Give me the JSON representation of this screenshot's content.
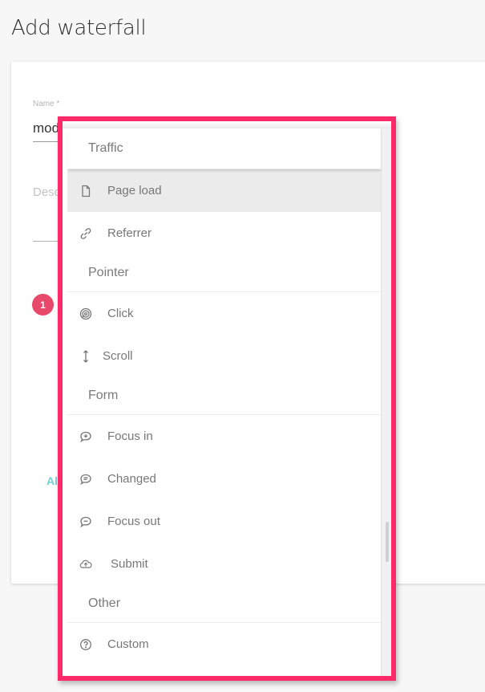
{
  "page": {
    "title": "Add waterfall"
  },
  "form": {
    "name_label": "Name *",
    "name_value": "mod",
    "description_placeholder": "Desc",
    "step_badge": "1",
    "add_link": "Al"
  },
  "dropdown": {
    "groups": [
      {
        "header": "Traffic",
        "items": [
          {
            "label": "Page load",
            "icon": "file-icon",
            "active": true
          },
          {
            "label": "Referrer",
            "icon": "link-icon",
            "active": false
          }
        ]
      },
      {
        "header": "Pointer",
        "items": [
          {
            "label": "Click",
            "icon": "fingerprint-icon",
            "active": false
          },
          {
            "label": "Scroll",
            "icon": "vertical-arrows-icon",
            "active": false
          }
        ]
      },
      {
        "header": "Form",
        "items": [
          {
            "label": "Focus in",
            "icon": "comment-plus-icon",
            "active": false
          },
          {
            "label": "Changed",
            "icon": "comment-lines-icon",
            "active": false
          },
          {
            "label": "Focus out",
            "icon": "comment-minus-icon",
            "active": false
          },
          {
            "label": "Submit",
            "icon": "cloud-upload-icon",
            "active": false
          }
        ]
      },
      {
        "header": "Other",
        "items": [
          {
            "label": "Custom",
            "icon": "question-circle-icon",
            "active": false
          }
        ]
      }
    ]
  },
  "colors": {
    "highlight": "#fd2a6a",
    "badge": "#e8486a",
    "link": "#6dcfd6"
  }
}
